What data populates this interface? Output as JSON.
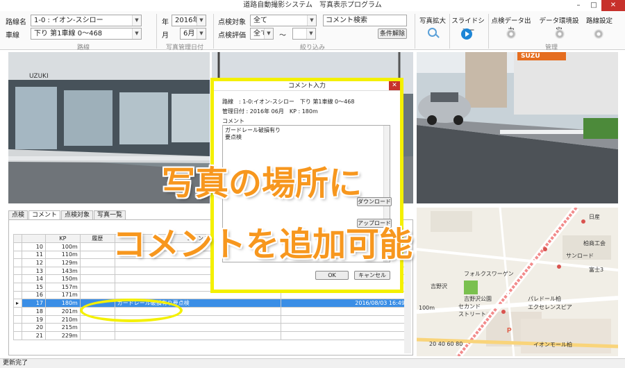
{
  "window": {
    "title": "道路自動撮影システム　写真表示プログラム",
    "min": "–",
    "max": "□",
    "close": "✕"
  },
  "ribbon": {
    "route_label": "路線名",
    "route_value": "1-0 : イオン-スシロー",
    "lane_label": "車線",
    "lane_value": "下り 第1車線 0～468",
    "year_label": "年",
    "year_value": "2016年",
    "month_label": "月",
    "month_value": "6月",
    "inspect_target_label": "点検対象",
    "inspect_target_value": "全て",
    "inspect_eval_label": "点検評価",
    "inspect_eval_value": "全て",
    "tilde": "～",
    "comment_search_value": "コメント検索",
    "clear_button": "条件解除",
    "group_route": "路線",
    "group_photo_date": "写真管理日付",
    "group_filter": "絞り込み",
    "group_manage": "管理",
    "tools": {
      "zoom": "写真拡大",
      "slideshow": "スライドショー",
      "export": "点検データ出力",
      "env": "データ環境設定",
      "route_settings": "路線設定"
    }
  },
  "photo_signs": {
    "sign_right": "SUZU",
    "sign_left": "UZUKI"
  },
  "tabs": [
    "点検",
    "コメント",
    "点検対象",
    "写真一覧"
  ],
  "grid": {
    "headers": [
      "",
      "",
      "KP",
      "履歴",
      "コメント",
      ""
    ],
    "rows": [
      {
        "marker": "",
        "no": "10",
        "kp": "100m",
        "hist": "",
        "comment": "",
        "date": ""
      },
      {
        "marker": "",
        "no": "11",
        "kp": "110m",
        "hist": "",
        "comment": "",
        "date": ""
      },
      {
        "marker": "",
        "no": "12",
        "kp": "129m",
        "hist": "",
        "comment": "",
        "date": ""
      },
      {
        "marker": "",
        "no": "13",
        "kp": "143m",
        "hist": "",
        "comment": "",
        "date": ""
      },
      {
        "marker": "",
        "no": "14",
        "kp": "150m",
        "hist": "",
        "comment": "",
        "date": ""
      },
      {
        "marker": "",
        "no": "15",
        "kp": "157m",
        "hist": "",
        "comment": "",
        "date": ""
      },
      {
        "marker": "",
        "no": "16",
        "kp": "171m",
        "hist": "",
        "comment": "",
        "date": ""
      },
      {
        "marker": "▸",
        "no": "17",
        "kp": "180m",
        "hist": "",
        "comment": "ガードレール破損有り要点検",
        "date": "2016/08/03 16:49"
      },
      {
        "marker": "",
        "no": "18",
        "kp": "201m",
        "hist": "",
        "comment": "",
        "date": ""
      },
      {
        "marker": "",
        "no": "19",
        "kp": "210m",
        "hist": "",
        "comment": "",
        "date": ""
      },
      {
        "marker": "",
        "no": "20",
        "kp": "215m",
        "hist": "",
        "comment": "",
        "date": ""
      },
      {
        "marker": "",
        "no": "21",
        "kp": "229m",
        "hist": "",
        "comment": "",
        "date": ""
      }
    ]
  },
  "dialog": {
    "title": "コメント入力",
    "route_line": "路線　: 1-0:イオン-スシロー　下り 第1車線 0～468",
    "date_line": "管理日付 : 2016年 06月　KP : 180m",
    "comment_label": "コメント",
    "comment_line1": "ガードレール破損有り",
    "comment_line2": "要点検",
    "download": "ダウンロード",
    "upload": "アップロード",
    "ok": "OK",
    "cancel": "キャンセル"
  },
  "map": {
    "labels": {
      "nissan": "日産",
      "kashiwa_kumiai": "柏商工会",
      "sunroad": "サンロード",
      "fuji": "富士3",
      "volkswagen": "フォルクスワーゲン",
      "yoshinozawa": "吉野沢",
      "yoshinozawa_park": "吉野沢公園",
      "second_street": "セカンド\nストリート",
      "bread": "パレドール柏",
      "excel": "エクセレンスピア",
      "aeon": "イオンモール柏",
      "scale": "100m",
      "scale_bottom": "20 40 60 80"
    }
  },
  "status": "更新完了",
  "caption": {
    "line1": "写真の場所に",
    "line2": "コメントを追加可能"
  }
}
